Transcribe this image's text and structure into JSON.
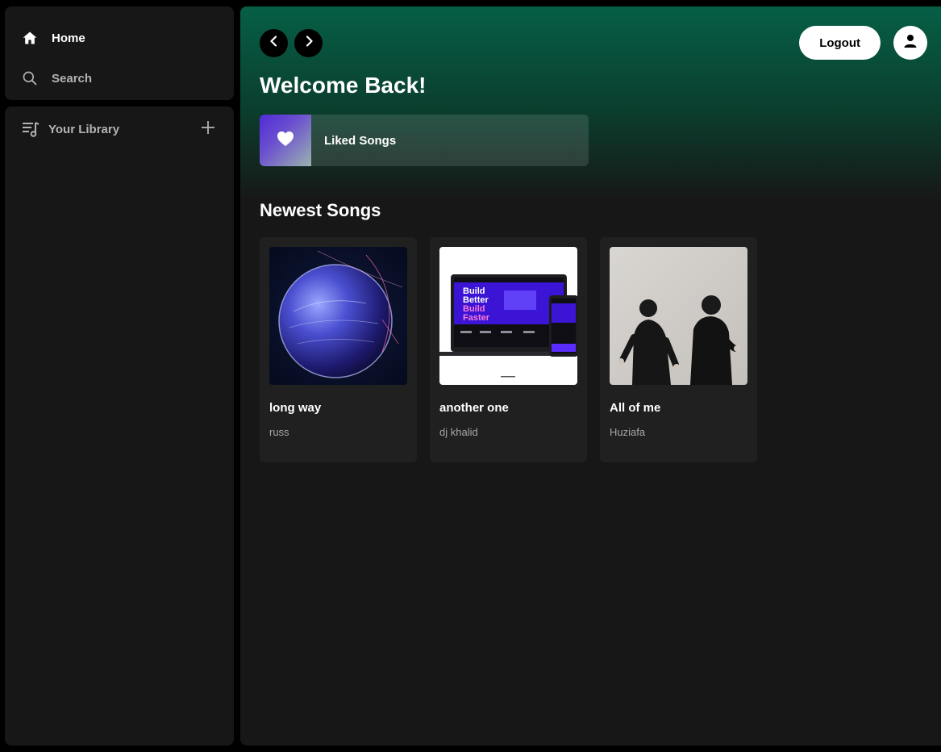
{
  "sidebar": {
    "nav": [
      {
        "label": "Home",
        "icon": "home-icon",
        "active": true
      },
      {
        "label": "Search",
        "icon": "search-icon",
        "active": false
      }
    ],
    "library": {
      "label": "Your Library",
      "icon": "library-icon",
      "add_icon": "plus-icon"
    }
  },
  "header": {
    "back_icon": "chevron-left-icon",
    "forward_icon": "chevron-right-icon",
    "logout_label": "Logout",
    "user_icon": "user-icon"
  },
  "main": {
    "welcome": "Welcome Back!",
    "liked": {
      "label": "Liked Songs",
      "icon": "heart-icon"
    },
    "newest_title": "Newest Songs",
    "songs": [
      {
        "title": "long way",
        "artist": "russ"
      },
      {
        "title": "another one",
        "artist": "dj khalid"
      },
      {
        "title": "All of me",
        "artist": "Huziafa"
      }
    ]
  },
  "art_text": {
    "line1": "Build",
    "line2": "Better",
    "line3": "Build",
    "line4": "Faster"
  },
  "colors": {
    "hero_top": "#065f46",
    "panel": "#171717",
    "card": "#202020",
    "accent_purple": "#4f2bd6"
  }
}
